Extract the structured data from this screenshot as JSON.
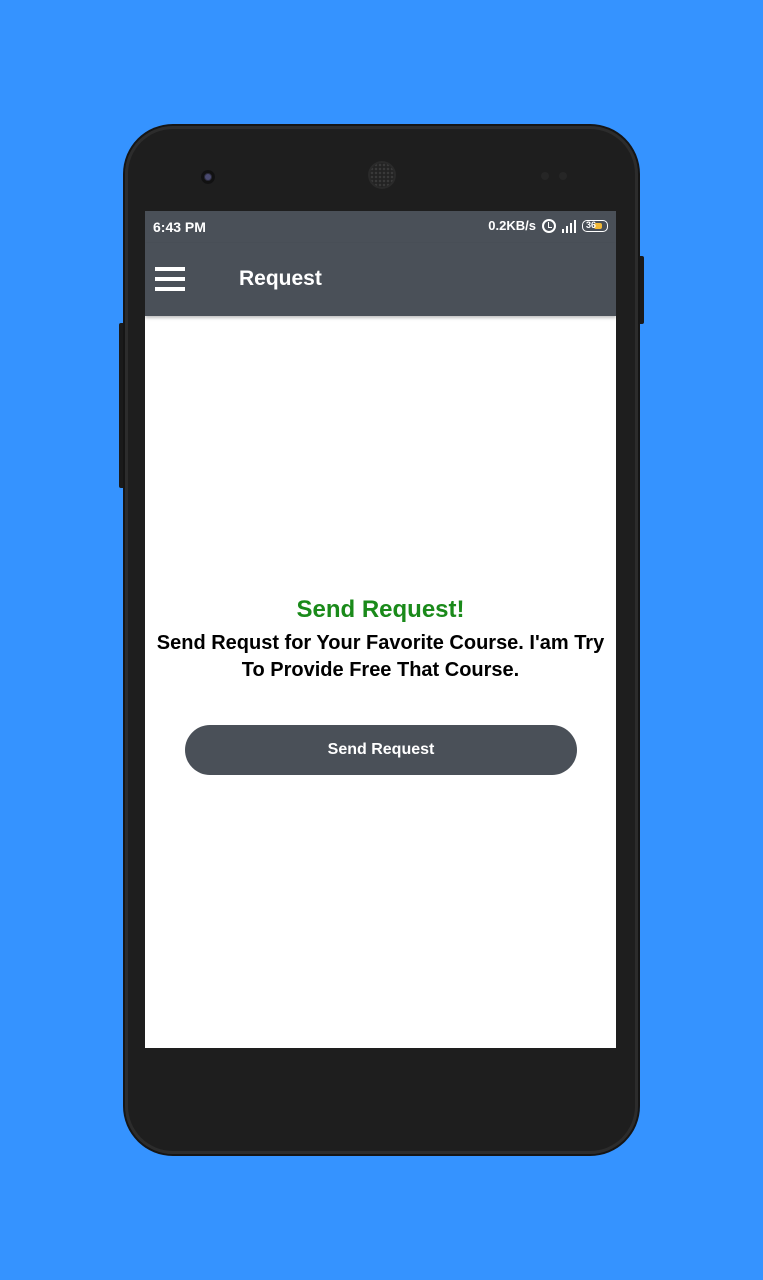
{
  "status_bar": {
    "time": "6:43 PM",
    "network_speed": "0.2KB/s",
    "battery": "36"
  },
  "app_bar": {
    "title": "Request"
  },
  "main": {
    "headline": "Send Request!",
    "description": "Send Requst for Your Favorite Course. I'am Try To Provide Free That Course.",
    "button_label": "Send Request"
  },
  "colors": {
    "background": "#3593ff",
    "app_bar": "#4a5058",
    "headline": "#1a8a1a",
    "button": "#4a5058"
  }
}
